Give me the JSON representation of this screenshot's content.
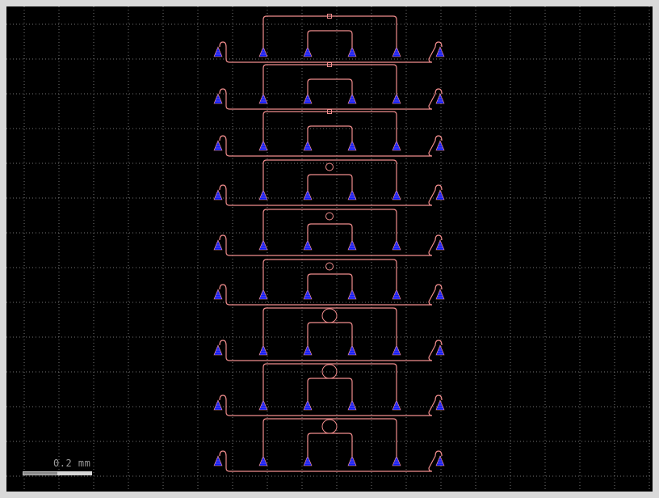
{
  "viewer": {
    "scale_label": "0.2 mm",
    "colors": {
      "background": "#000000",
      "grid": "#9a9a9a",
      "waveguide": "#f08c8c",
      "coupler_fill": "#0a1cff",
      "coupler_outline": "#ff9a9a"
    }
  },
  "layout": {
    "rows": 9,
    "couplers_per_row": 6,
    "ring_styles": [
      "small-square",
      "small-square",
      "small-square",
      "medium-ring",
      "medium-ring",
      "medium-ring",
      "large-ring",
      "large-ring",
      "large-ring"
    ]
  }
}
